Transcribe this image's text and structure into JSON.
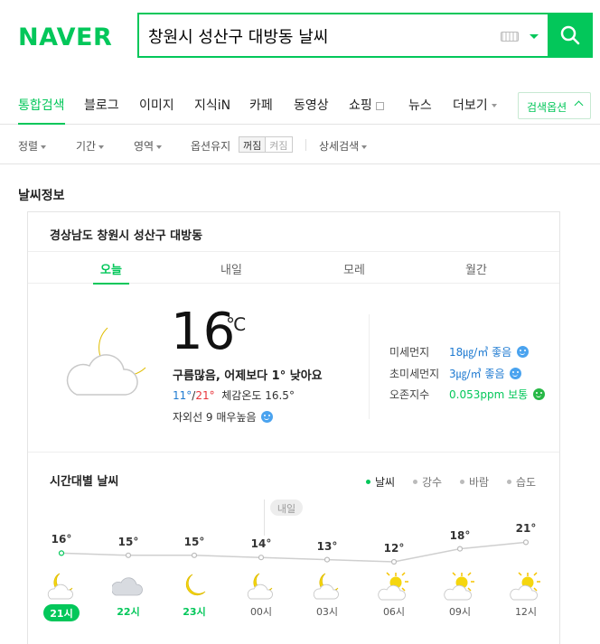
{
  "header": {
    "logo": "NAVER",
    "search_query": "창원시 성산구 대방동 날씨"
  },
  "tabs": [
    {
      "label": "통합검색",
      "active": true
    },
    {
      "label": "블로그"
    },
    {
      "label": "이미지"
    },
    {
      "label": "지식iN"
    },
    {
      "label": "카페"
    },
    {
      "label": "동영상"
    },
    {
      "label": "쇼핑"
    },
    {
      "label": "뉴스"
    },
    {
      "label": "더보기"
    }
  ],
  "search_options_label": "검색옵션",
  "filters": {
    "sort": "정렬",
    "period": "기간",
    "area": "영역",
    "keep_option": "옵션유지",
    "off": "꺼짐",
    "on": "켜짐",
    "detail": "상세검색"
  },
  "weather": {
    "section_title": "날씨정보",
    "location": "경상남도 창원시 성산구 대방동",
    "day_tabs": [
      "오늘",
      "내일",
      "모레",
      "월간"
    ],
    "current_temp": "16",
    "temp_unit": "℃",
    "summary": "구름많음, 어제보다 1° 낮아요",
    "min": "11°",
    "slash": "/",
    "max": "21°",
    "feels_like": "체감온도 16.5°",
    "uv": "자외선 9 매우높음",
    "dust": [
      {
        "label": "미세먼지",
        "value": "18㎍/㎥ 좋음",
        "color": "#1e7ad1"
      },
      {
        "label": "초미세먼지",
        "value": "3㎍/㎥ 좋음",
        "color": "#1e7ad1"
      },
      {
        "label": "오존지수",
        "value": "0.053ppm 보통",
        "color": "#03c75a"
      }
    ],
    "hourly_title": "시간대별 날씨",
    "legend": [
      "날씨",
      "강수",
      "바람",
      "습도"
    ],
    "tomorrow_badge": "내일"
  },
  "chart_data": {
    "type": "line",
    "x": [
      "21시",
      "22시",
      "23시",
      "00시",
      "03시",
      "06시",
      "09시",
      "12시"
    ],
    "series": [
      {
        "values": [
          16,
          15,
          15,
          14,
          13,
          12,
          18,
          21
        ]
      }
    ],
    "labels": [
      "16°",
      "15°",
      "15°",
      "14°",
      "13°",
      "12°",
      "18°",
      "21°"
    ],
    "icons": [
      "moon-cloud",
      "cloud",
      "moon",
      "moon-cloud",
      "moon-cloud",
      "sun-cloud",
      "sun-cloud",
      "sun-cloud"
    ],
    "current_index": 0
  },
  "colors": {
    "brand": "#03c75a",
    "min_temp": "#1e7ad1",
    "max_temp": "#e8353b"
  }
}
